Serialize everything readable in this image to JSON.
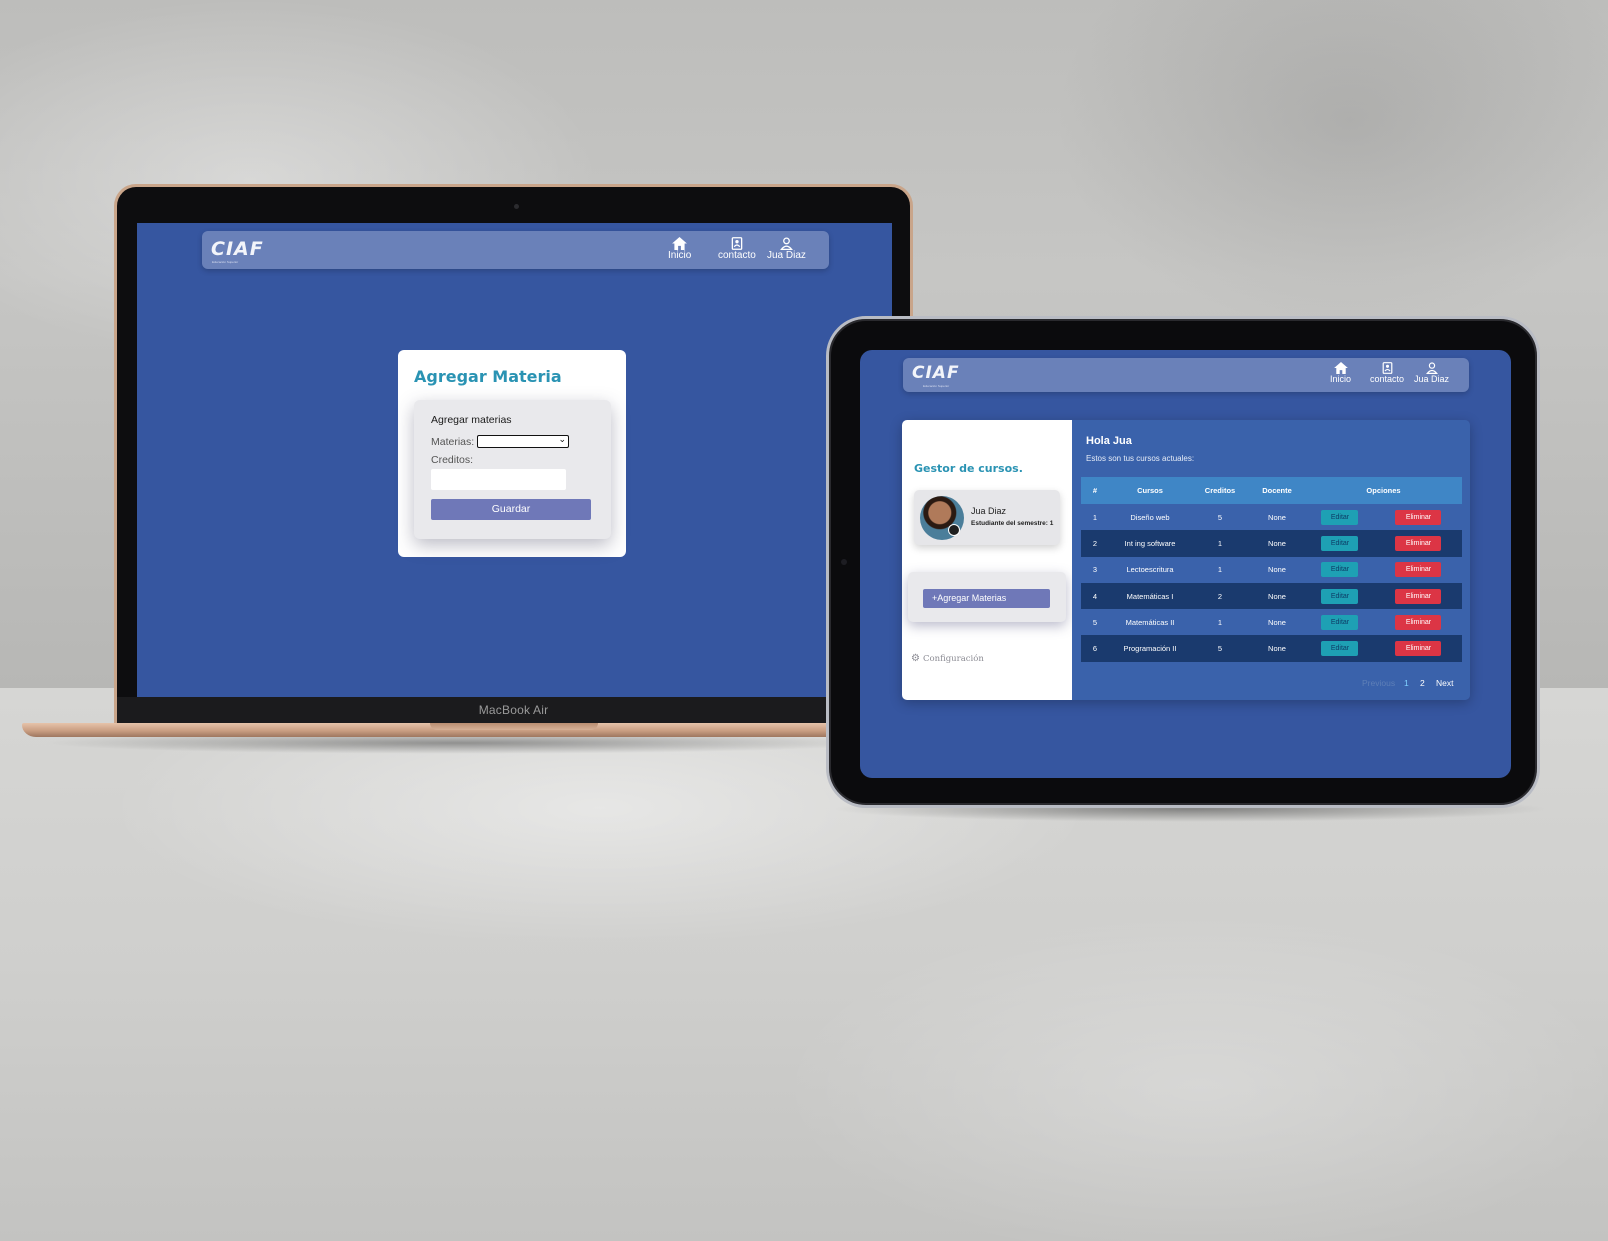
{
  "laptop": {
    "brand_label": "MacBook Air",
    "nav": {
      "logo": "CIAF",
      "logo_sub": "Educación Superior",
      "items": [
        {
          "label": "Inicio",
          "icon": "home-icon"
        },
        {
          "label": "contacto",
          "icon": "contact-book-icon"
        },
        {
          "label": "Jua Diaz",
          "icon": "user-icon"
        }
      ]
    },
    "form": {
      "title": "Agregar Materia",
      "heading": "Agregar materias",
      "materias_label": "Materias:",
      "materias_value": "",
      "creditos_label": "Creditos:",
      "creditos_value": "",
      "save_button": "Guardar"
    }
  },
  "tablet": {
    "nav": {
      "logo": "CIAF",
      "logo_sub": "Educación Superior",
      "items": [
        {
          "label": "Inicio",
          "icon": "home-icon"
        },
        {
          "label": "contacto",
          "icon": "contact-book-icon"
        },
        {
          "label": "Jua Diaz",
          "icon": "user-icon"
        }
      ]
    },
    "sidebar": {
      "title": "Gestor de cursos.",
      "profile_name": "Jua Diaz",
      "profile_subtitle": "Estudiante del semestre: 1",
      "add_button": "+Agregar Materias",
      "settings_label": "Configuración"
    },
    "main": {
      "greeting": "Hola Jua",
      "description": "Estos son tus cursos actuales:",
      "columns": [
        "#",
        "Cursos",
        "Creditos",
        "Docente",
        "Opciones"
      ],
      "edit_label": "Editar",
      "delete_label": "Eliminar",
      "rows": [
        {
          "num": "1",
          "curso": "Diseño web",
          "creditos": "5",
          "docente": "None"
        },
        {
          "num": "2",
          "curso": "Int ing software",
          "creditos": "1",
          "docente": "None"
        },
        {
          "num": "3",
          "curso": "Lectoescritura",
          "creditos": "1",
          "docente": "None"
        },
        {
          "num": "4",
          "curso": "Matemáticas I",
          "creditos": "2",
          "docente": "None"
        },
        {
          "num": "5",
          "curso": "Matemáticas II",
          "creditos": "1",
          "docente": "None"
        },
        {
          "num": "6",
          "curso": "Programación II",
          "creditos": "5",
          "docente": "None"
        }
      ],
      "pagination": {
        "previous": "Previous",
        "pages": [
          "1",
          "2"
        ],
        "next": "Next",
        "current": "1"
      }
    }
  },
  "colors": {
    "screen_bg": "#3656a0",
    "accent_teal": "#2a93b3",
    "button_purple": "#6f78b8",
    "edit_button": "#1ea0b4",
    "delete_button": "#dc3545"
  }
}
